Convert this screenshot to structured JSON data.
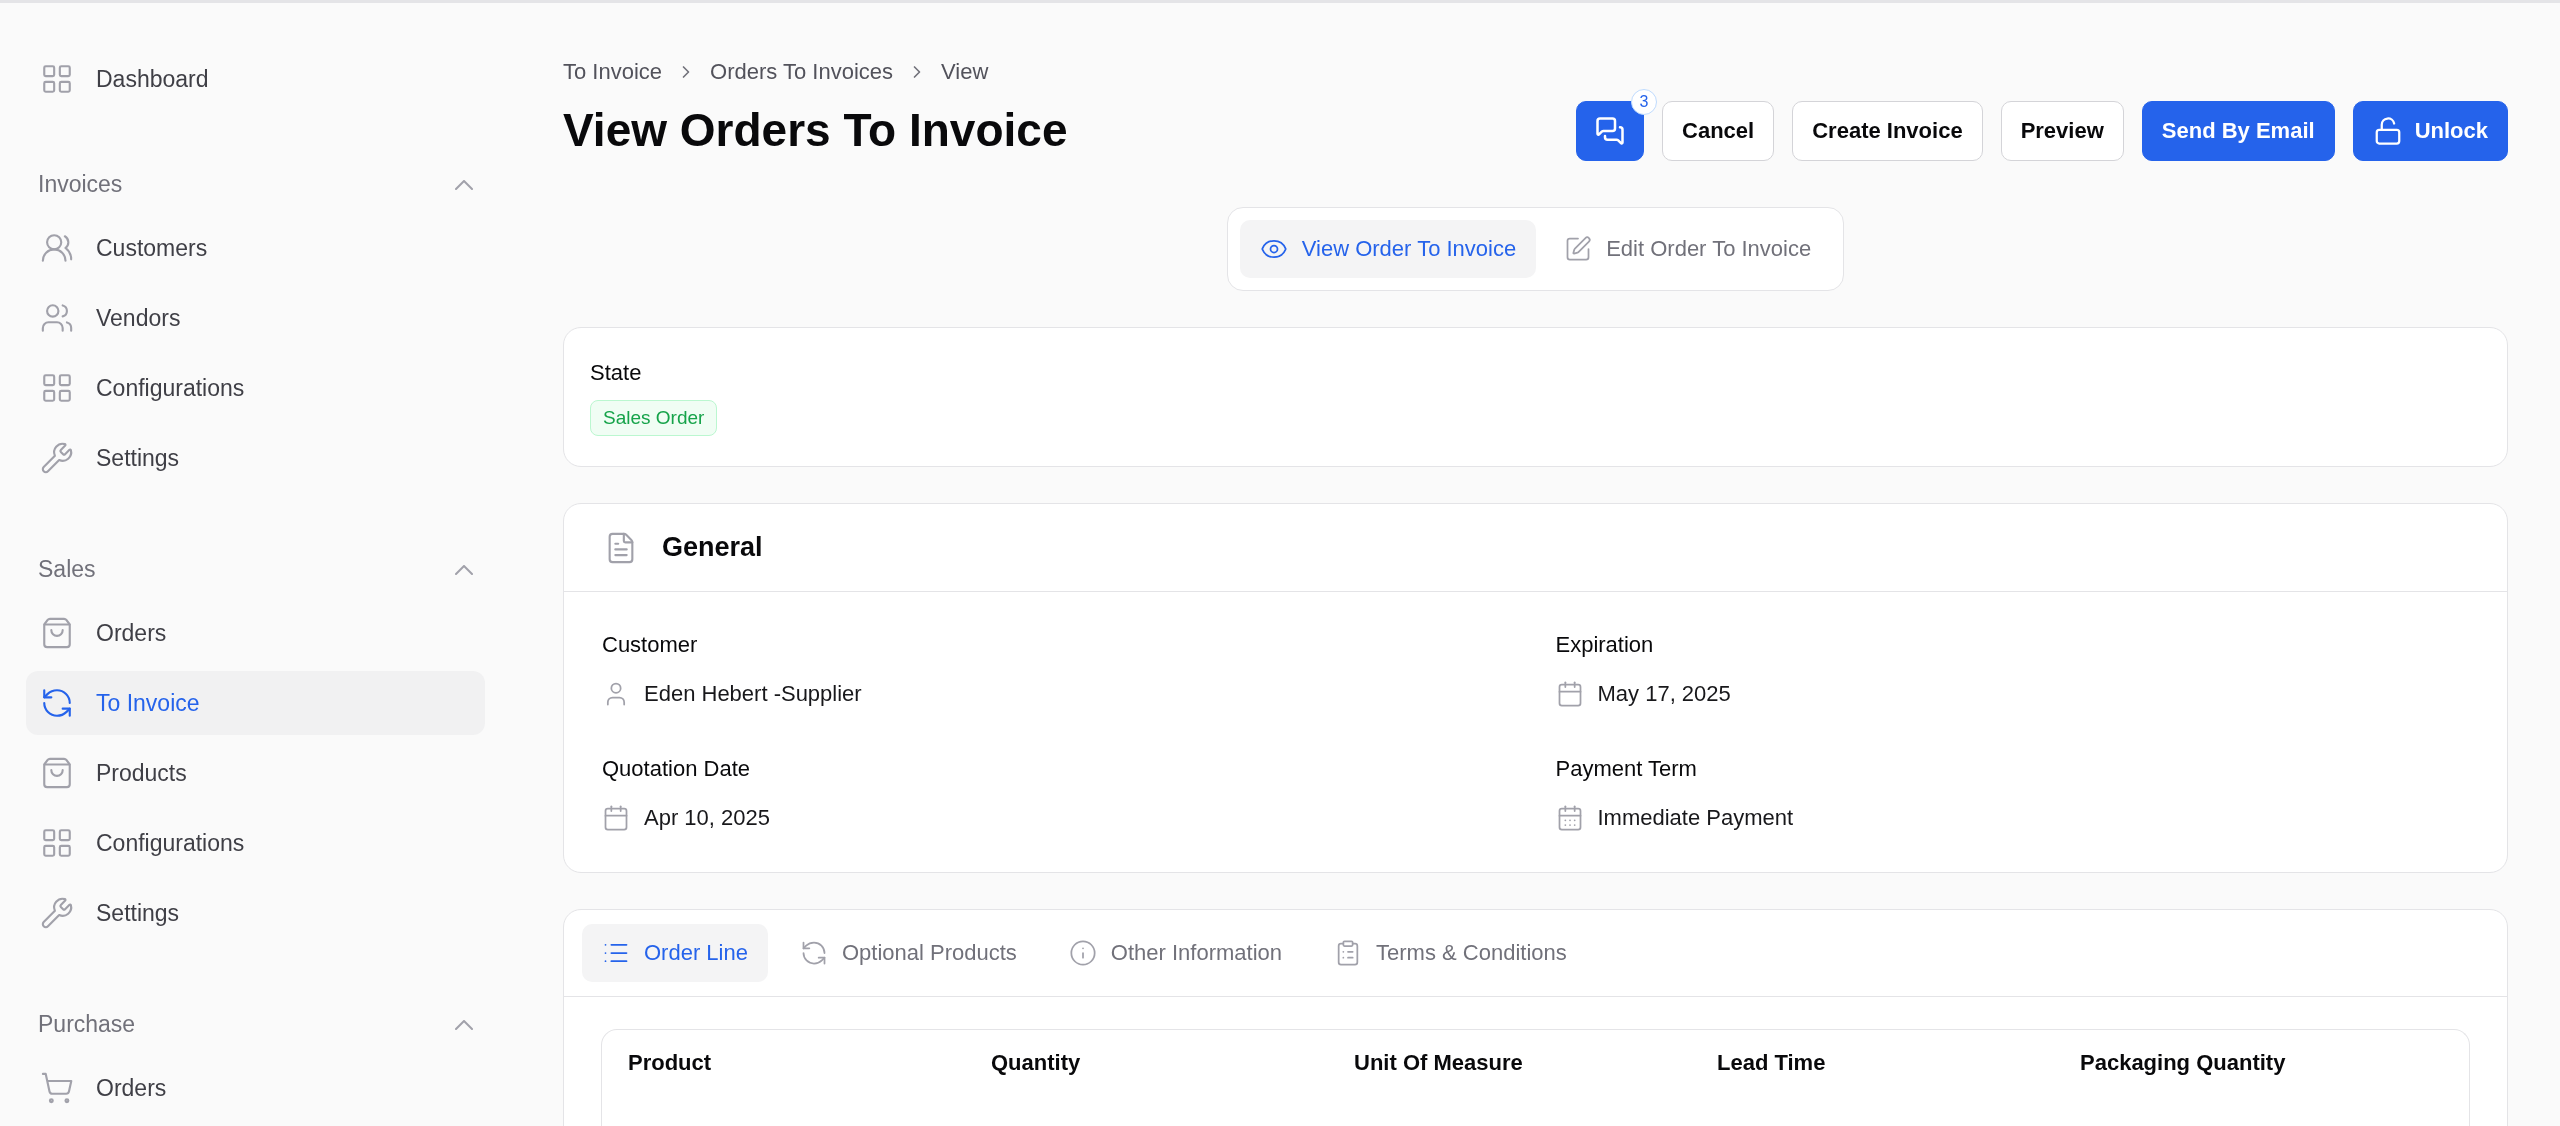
{
  "sidebar": {
    "top_item": {
      "label": "Dashboard",
      "kind": "grid",
      "selected": false
    },
    "sections": [
      {
        "title": "Invoices",
        "expanded": true,
        "items": [
          {
            "label": "Customers",
            "kind": "users",
            "selected": false
          },
          {
            "label": "Vendors",
            "kind": "group",
            "selected": false
          },
          {
            "label": "Configurations",
            "kind": "grid",
            "selected": false
          },
          {
            "label": "Settings",
            "kind": "wrench",
            "selected": false
          }
        ]
      },
      {
        "title": "Sales",
        "expanded": true,
        "items": [
          {
            "label": "Orders",
            "kind": "bag",
            "selected": false
          },
          {
            "label": "To Invoice",
            "kind": "sync",
            "selected": true
          },
          {
            "label": "Products",
            "kind": "bag",
            "selected": false
          },
          {
            "label": "Configurations",
            "kind": "grid",
            "selected": false
          },
          {
            "label": "Settings",
            "kind": "wrench",
            "selected": false
          }
        ]
      },
      {
        "title": "Purchase",
        "expanded": true,
        "items": [
          {
            "label": "Orders",
            "kind": "cart",
            "selected": false
          }
        ]
      }
    ]
  },
  "breadcrumb": [
    "To Invoice",
    "Orders To Invoices",
    "View"
  ],
  "title": "View Orders To Invoice",
  "actions": [
    {
      "kind": "chat",
      "badge": "3"
    },
    {
      "kind": "secondary",
      "label": "Cancel"
    },
    {
      "kind": "secondary",
      "label": "Create Invoice"
    },
    {
      "kind": "secondary",
      "label": "Preview"
    },
    {
      "kind": "primary",
      "label": "Send By Email"
    },
    {
      "kind": "unlock",
      "label": "Unlock"
    }
  ],
  "view_switch": [
    {
      "label": "View Order To Invoice",
      "kind": "eye",
      "selected": true
    },
    {
      "label": "Edit Order To Invoice",
      "kind": "pencil",
      "selected": false
    }
  ],
  "state": {
    "label": "State",
    "badge": "Sales Order"
  },
  "general": {
    "title": "General",
    "fields": [
      {
        "label": "Customer",
        "value": "Eden Hebert -Supplier",
        "kind": "person"
      },
      {
        "label": "Expiration",
        "value": "May 17, 2025",
        "kind": "calendar"
      },
      {
        "label": "Quotation Date",
        "value": "Apr 10, 2025",
        "kind": "calendar"
      },
      {
        "label": "Payment Term",
        "value": "Immediate Payment",
        "kind": "calendar-grid"
      }
    ]
  },
  "tabs": [
    {
      "label": "Order Line",
      "kind": "list",
      "selected": true
    },
    {
      "label": "Optional Products",
      "kind": "sync",
      "selected": false
    },
    {
      "label": "Other Information",
      "kind": "info",
      "selected": false
    },
    {
      "label": "Terms & Conditions",
      "kind": "clipboard",
      "selected": false
    }
  ],
  "table": {
    "columns": [
      "Product",
      "Quantity",
      "Unit Of Measure",
      "Lead Time",
      "Packaging Quantity"
    ]
  }
}
